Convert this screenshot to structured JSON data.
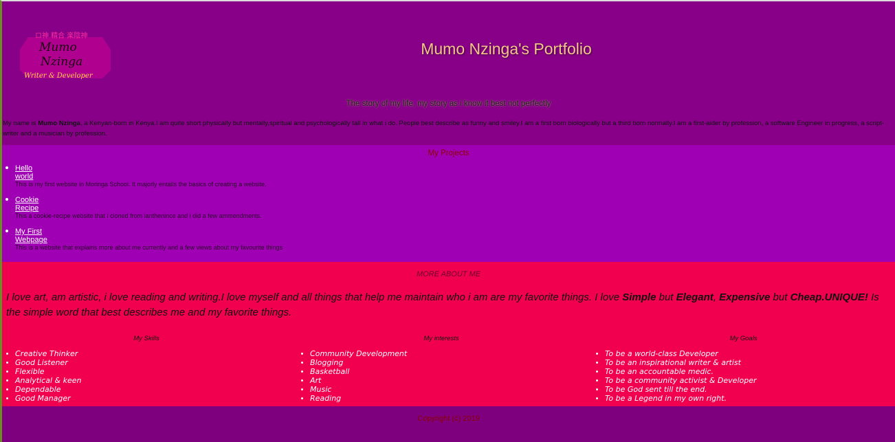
{
  "header": {
    "logo": {
      "line1": "Mumo",
      "line2": "Nzinga",
      "subtitle": "Writer & Developer",
      "glyphs": "ロ神 精合 楽陰神",
      "badge_color": "#b0008f",
      "accent_color": "#ff2aa0"
    },
    "title": "Mumo Nzinga's Portfolio",
    "tagline": "The story of my life, my story as i know it best not perfectly",
    "bio": {
      "prefix": "My name is ",
      "name": "Mumo Nzinga",
      "rest": ", a Kenyan-born in Kenya.I am quite short physically but mentally,spiritual and psychologically tall in what i do. People best describe as funny and smiley.I am a first born biologically but a third born normally.I am a first-aider by profession, a software Engineer in progress, a script-writer and a musician by profession."
    }
  },
  "projects": {
    "title": "My Projects",
    "items": [
      {
        "link": "Hello world",
        "description": "This is my first website in Moringa School. It majorly entails the basics of creating a website."
      },
      {
        "link": "Cookie Recipe",
        "description": "This a cookie-recipe website that i cloned from ianthenince and i did a few ammendments."
      },
      {
        "link": "My First Webpage",
        "description": "This is a website that explains more about me currently and a few views about my favourite things"
      }
    ]
  },
  "about": {
    "title": "MORE ABOUT ME",
    "text_parts": {
      "p1": "I love art, am artistic, i love reading and writing.I love myself and all things that help me maintain who i am are my favorite things. I love ",
      "b1": "Simple",
      "p2": " but ",
      "b2": "Elegant",
      "p3": ", ",
      "b3": "Expensive",
      "p4": " but ",
      "b4": "Cheap.UNIQUE!",
      "p5": " Is the simple word that best describes me and my favorite things."
    },
    "skills": {
      "title": "My Skills",
      "items": [
        "Creative Thinker",
        "Good Listener",
        "Flexible",
        "Analytical & keen",
        "Dependable",
        "Good Manager"
      ]
    },
    "interests": {
      "title": "My interests",
      "items": [
        "Community Development",
        "Blogging",
        "Basketball",
        "Art",
        "Music",
        "Reading"
      ]
    },
    "goals": {
      "title": "My Goals",
      "items": [
        "To be a world-class Developer",
        "To be an inspirational writer & artist",
        "To be an accountable medic.",
        "To be a community activist & Developer",
        "To be God sent till the end.",
        "To be a Legend in my own right."
      ]
    }
  },
  "footer": {
    "copyright": "Copyright (c) 2019"
  },
  "colors": {
    "header_bg": "#880088",
    "projects_bg": "#a000b4",
    "about_bg": "#f0004f",
    "footer_bg": "#7f007f",
    "title_color": "#f5c58a"
  }
}
